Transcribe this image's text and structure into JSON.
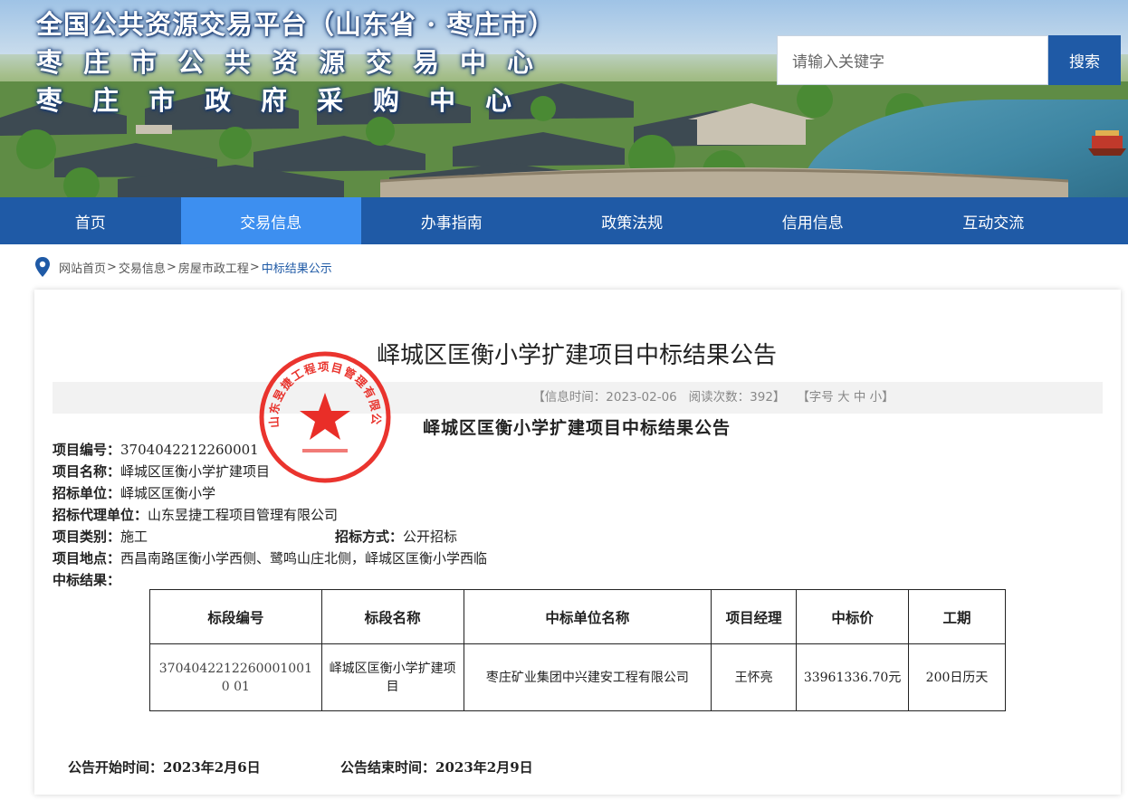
{
  "header": {
    "title_line1": "全国公共资源交易平台（山东省 · 枣庄市）",
    "title_line2": "枣庄市公共资源交易中心",
    "title_line3": "枣庄市政府采购中心",
    "search_placeholder": "请输入关键字",
    "search_button": "搜索"
  },
  "nav": {
    "items": [
      {
        "label": "首页"
      },
      {
        "label": "交易信息"
      },
      {
        "label": "办事指南"
      },
      {
        "label": "政策法规"
      },
      {
        "label": "信用信息"
      },
      {
        "label": "互动交流"
      }
    ],
    "active_index": 1
  },
  "breadcrumb": {
    "items": [
      "网站首页",
      "交易信息",
      "房屋市政工程",
      "中标结果公示"
    ],
    "separator": ">"
  },
  "article": {
    "title": "峄城区匡衡小学扩建项目中标结果公告",
    "info_date": "【信息时间：2023-02-06",
    "info_views": "阅读次数：392】",
    "info_font": "【字号 大 中 小】",
    "doc_title": "峄城区匡衡小学扩建项目中标结果公告",
    "fields": {
      "project_no_label": "项目编号：",
      "project_no": "3704042212260001",
      "project_name_label": "项目名称：",
      "project_name": "峄城区匡衡小学扩建项目",
      "tenderer_label": "招标单位：",
      "tenderer": "峄城区匡衡小学",
      "agent_label": "招标代理单位：",
      "agent": "山东昱捷工程项目管理有限公司",
      "category_label": "项目类别：",
      "category": "施工",
      "method_label": "招标方式：",
      "method": "公开招标",
      "location_label": "项目地点：",
      "location": "西昌南路匡衡小学西侧、鹭鸣山庄北侧，峄城区匡衡小学西临",
      "result_label": "中标结果："
    },
    "table": {
      "headers": [
        "标段编号",
        "标段名称",
        "中标单位名称",
        "项目经理",
        "中标价",
        "工期"
      ],
      "rows": [
        [
          "37040422122600010010 01",
          "峄城区匡衡小学扩建项目",
          "枣庄矿业集团中兴建安工程有限公司",
          "王怀亮",
          "33961336.70元",
          "200日历天"
        ]
      ]
    },
    "start_label": "公告开始时间：",
    "start_date": "2023年2月6日",
    "end_label": "公告结束时间：",
    "end_date": "2023年2月9日"
  },
  "seal": {
    "text": "山东昱捷工程项目管理有限公司",
    "color": "#e8231c"
  },
  "colors": {
    "nav_bg": "#1f5aa6",
    "nav_active": "#3d8ff0",
    "breadcrumb_current": "#1f5aa6"
  }
}
